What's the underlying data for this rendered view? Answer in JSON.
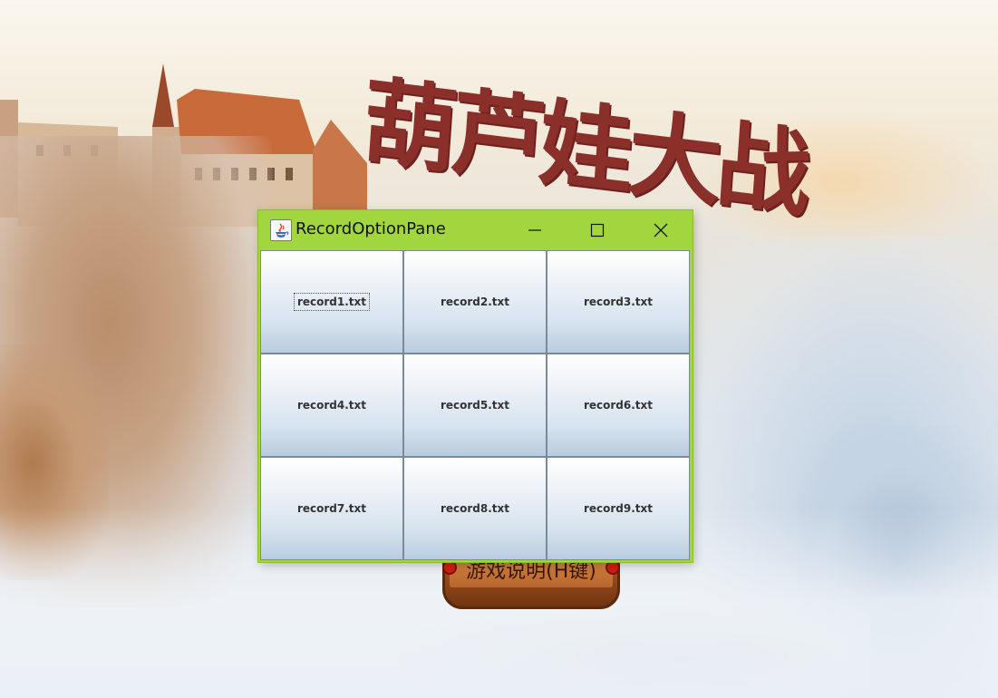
{
  "background": {
    "game_title": "葫芦娃大战",
    "instructions_button": "游戏说明(H键)"
  },
  "window": {
    "title": "RecordOptionPane",
    "icon": "java-icon",
    "controls": {
      "minimize": "minimize-icon",
      "maximize": "maximize-icon",
      "close": "close-icon"
    },
    "accent_color": "#a2d63f"
  },
  "records": [
    {
      "label": "record1.txt",
      "focused": true
    },
    {
      "label": "record2.txt",
      "focused": false
    },
    {
      "label": "record3.txt",
      "focused": false
    },
    {
      "label": "record4.txt",
      "focused": false
    },
    {
      "label": "record5.txt",
      "focused": false
    },
    {
      "label": "record6.txt",
      "focused": false
    },
    {
      "label": "record7.txt",
      "focused": false
    },
    {
      "label": "record8.txt",
      "focused": false
    },
    {
      "label": "record9.txt",
      "focused": false
    }
  ]
}
